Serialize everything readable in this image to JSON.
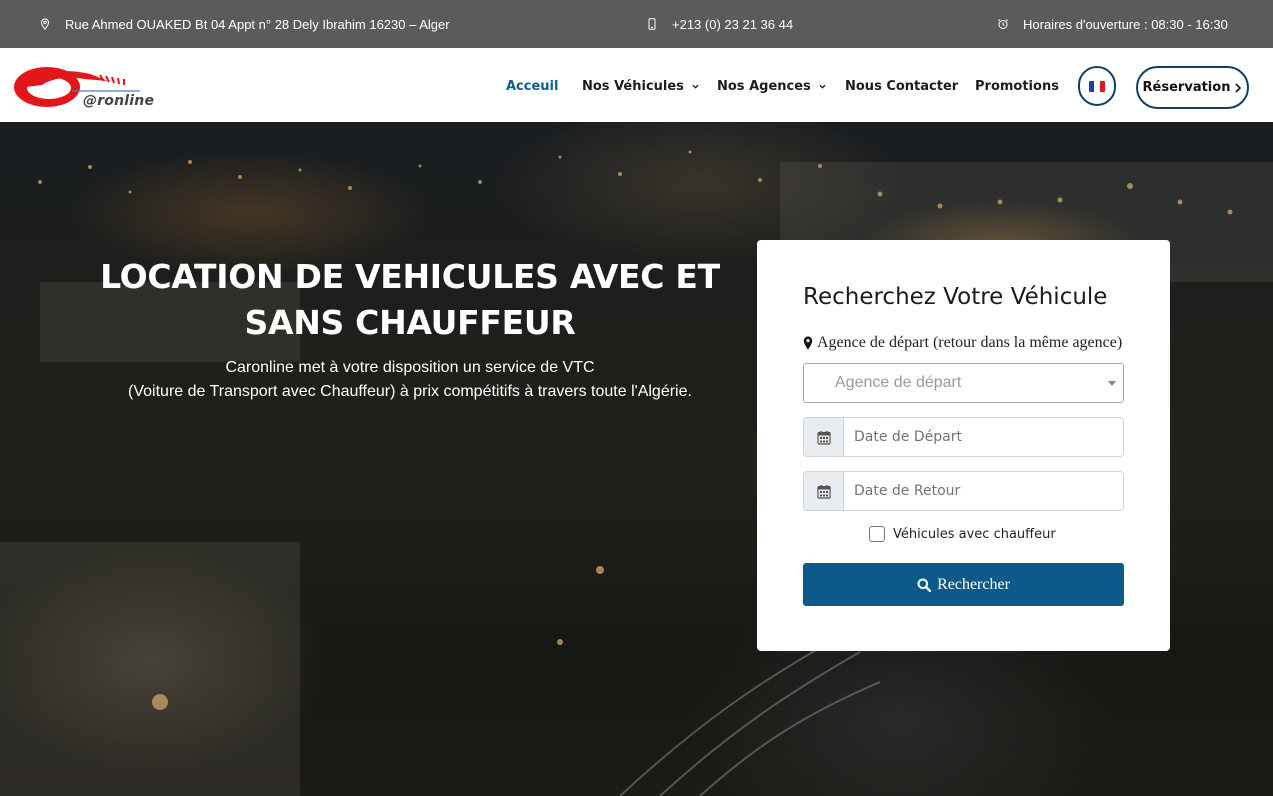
{
  "topbar": {
    "address": "Rue Ahmed OUAKED Bt 04 Appt n° 28 Dely Ibrahim 16230 – Alger",
    "address_icon": "map-pin-icon",
    "phone": "+213 (0) 23 21 36 44",
    "phone_icon": "mobile-phone-icon",
    "hours": "Horaires d'ouverture : 08:30 - 16:30",
    "hours_icon": "alarm-clock-icon"
  },
  "header": {
    "logo_text": "@ronline",
    "nav": [
      {
        "label": "Acceuil",
        "active": true
      },
      {
        "label": "Nos Véhicules",
        "dropdown": true
      },
      {
        "label": "Nos Agences",
        "dropdown": true
      },
      {
        "label": "Nous Contacter"
      },
      {
        "label": "Promotions"
      }
    ],
    "language_flag": "france-flag-icon",
    "reservation_label": "Réservation"
  },
  "hero": {
    "title_line1": "LOCATION DE VEHICULES AVEC ET",
    "title_line2": "SANS CHAUFFEUR",
    "subtitle_line1": "Caronline met à votre disposition un service de VTC",
    "subtitle_line2": "(Voiture de Transport avec Chauffeur) à prix compétitifs à travers toute l'Algérie."
  },
  "search_card": {
    "title": "Recherchez Votre Véhicule",
    "agency_label": "Agence de départ (retour dans la même agence)",
    "agency_placeholder": "Agence de départ",
    "departure_placeholder": "Date de Départ",
    "return_placeholder": "Date de Retour",
    "driver_checkbox_label": "Véhicules avec chauffeur",
    "driver_checked": false,
    "search_button": "Rechercher"
  },
  "colors": {
    "topbar_bg": "#5b5b5b",
    "accent": "#0f5e8c",
    "button_bg": "#0d5a8a",
    "outline": "#0f3f6b",
    "logo_red": "#e2161b"
  }
}
